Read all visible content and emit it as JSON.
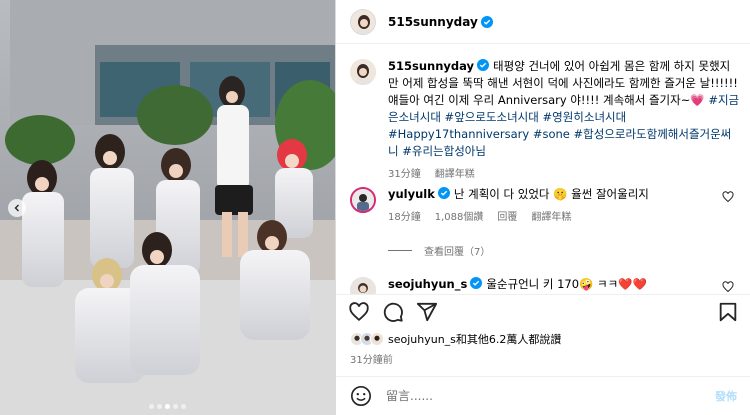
{
  "post": {
    "author": "515sunnyday",
    "caption": "태평양 건너에 있어 아쉽게 몸은 함께 하지 못했지만 어제 합성을 뚝딱 해낸 서현이 덕에 사진에라도 함께한 즐거운 날!!!!!! 얘들아 여긴 이제 우리 Anniversary 야!!!! 계속해서 즐기자~💗",
    "hashtags": "#지금은소녀시대 #앞으로도소녀시대 #영원히소녀시대 #Happy17thanniversary #sone #합성으로라도함께해서즐거운써니 #유리는합성아님",
    "time": "31分鐘",
    "translate_label": "翻譯年糕"
  },
  "comments": [
    {
      "username": "yulyulk",
      "text": "난 계획이 다 있었다 🤫 율썬 잘어울리지",
      "time": "18分鐘",
      "likes": "1,088個讚",
      "reply_label": "回覆",
      "translate_label": "翻譯年糕",
      "view_replies": "查看回覆（7）"
    },
    {
      "username": "seojuhyun_s",
      "text": "울순규언니 키 170🤪 ㅋㅋ❤️❤️"
    }
  ],
  "likes_text": "seojuhyun_s和其他6.2萬人都說讚",
  "post_time": "31分鐘前",
  "comment_box": {
    "placeholder": "留言......",
    "post_label": "發佈"
  },
  "carousel": {
    "slide_count": 5,
    "active_slide": 2
  },
  "icons": [
    "verified-icon",
    "heart-icon",
    "comment-icon",
    "share-icon",
    "bookmark-icon",
    "emoji-icon",
    "chevron-left-icon"
  ],
  "colors": {
    "verified": "#0095f6",
    "link": "#00376b",
    "secondary": "#737373",
    "post_button": "#b2dffc"
  }
}
